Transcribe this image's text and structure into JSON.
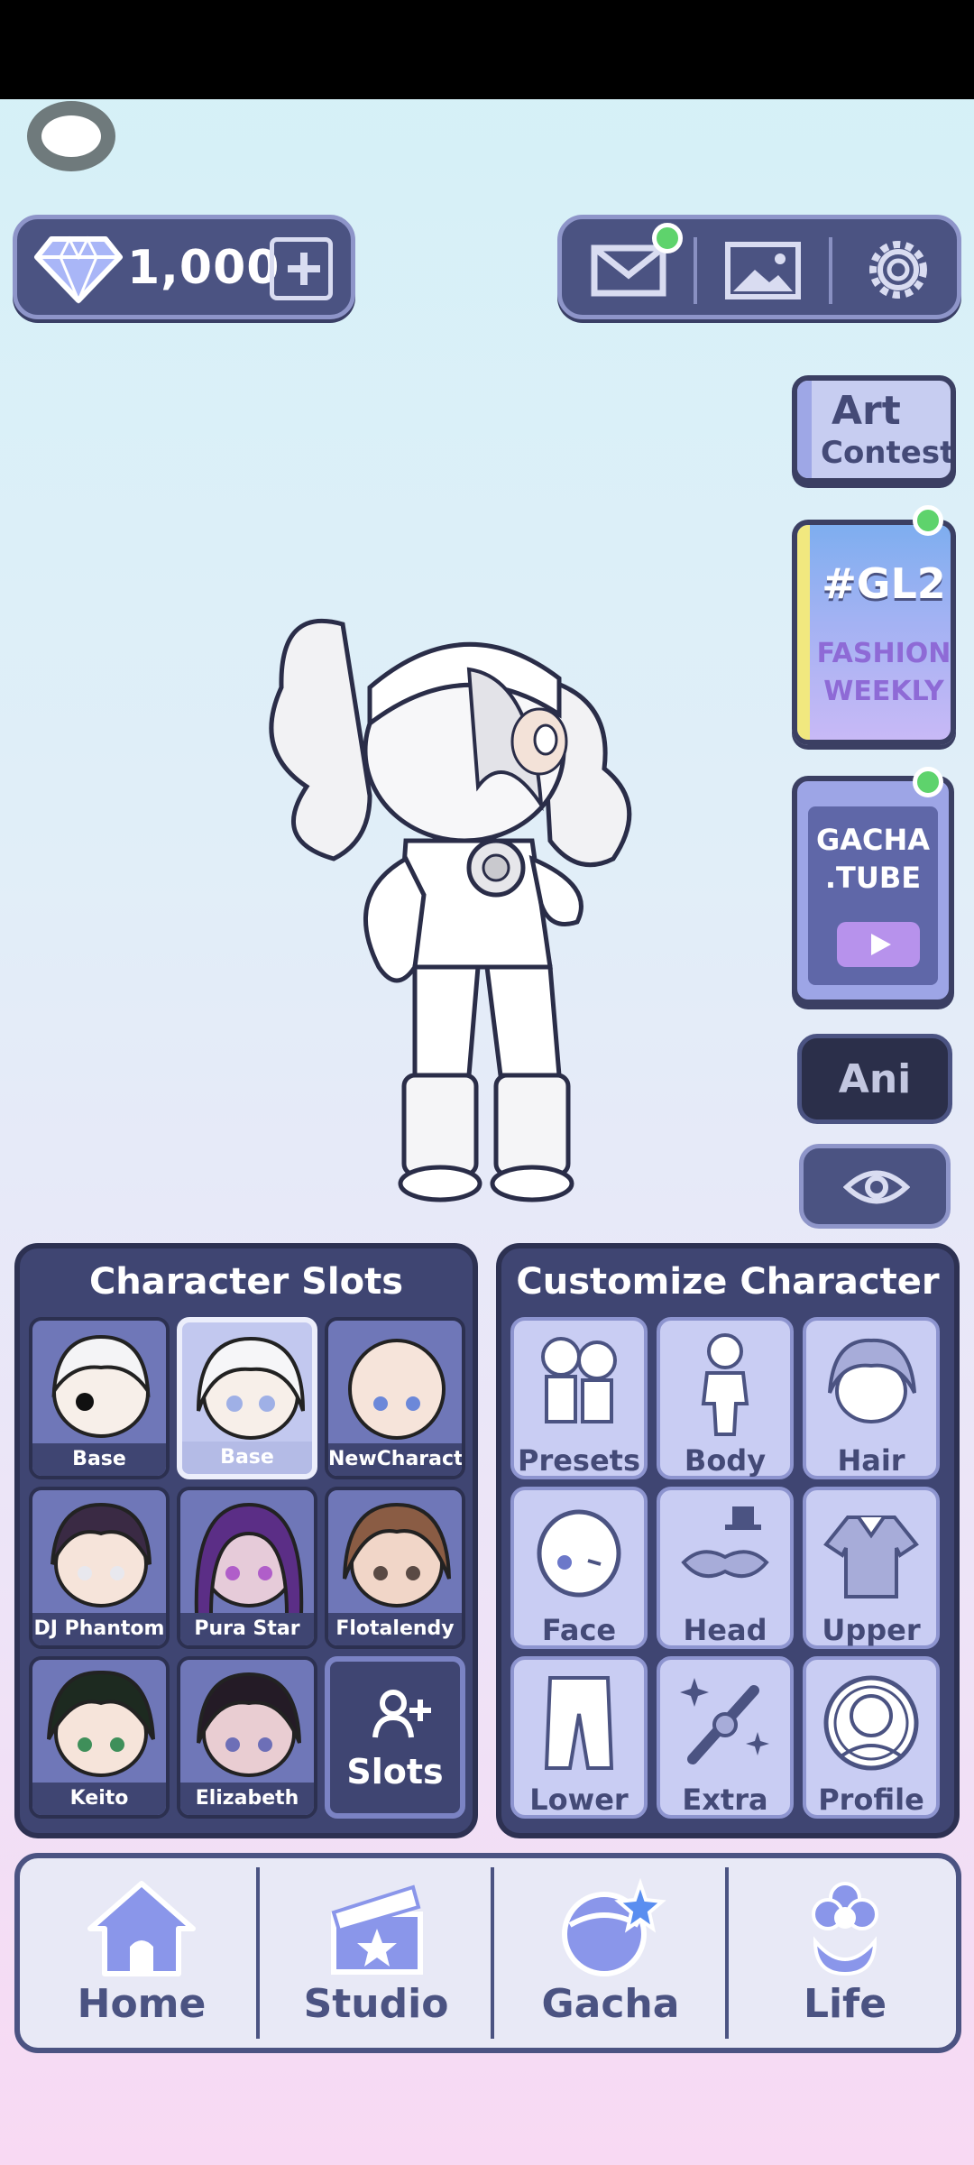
{
  "currency": {
    "gems": "1,000"
  },
  "header_icons": [
    "mail-icon",
    "gallery-icon",
    "settings-icon"
  ],
  "side_buttons": {
    "art_contest": [
      "Art",
      "Contest"
    ],
    "gl2": {
      "tag": "#GL2",
      "line1": "FASHION",
      "line2": "WEEKLY"
    },
    "gachatube": {
      "line1": "GACHA",
      "line2": ".TUBE"
    },
    "ani": "Ani"
  },
  "slots": {
    "title": "Character Slots",
    "items": [
      {
        "name": "Base"
      },
      {
        "name": "Base"
      },
      {
        "name": "NewCharacter"
      },
      {
        "name": "DJ Phantom"
      },
      {
        "name": "Pura Star"
      },
      {
        "name": "Flotalendy"
      },
      {
        "name": "Keito"
      },
      {
        "name": "Elizabeth"
      }
    ],
    "add_label": "Slots"
  },
  "customize": {
    "title": "Customize Character",
    "items": [
      "Presets",
      "Body",
      "Hair",
      "Face",
      "Head",
      "Upper",
      "Lower",
      "Extra",
      "Profile"
    ]
  },
  "nav": {
    "items": [
      "Home",
      "Studio",
      "Gacha",
      "Life"
    ]
  },
  "colors": {
    "panel": "#3f4572",
    "accent_green": "#5ed36c",
    "nav_text": "#4b5382"
  }
}
